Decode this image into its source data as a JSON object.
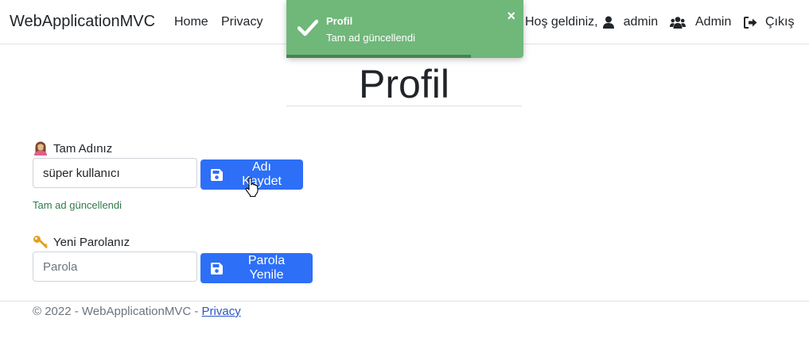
{
  "navbar": {
    "brand": "WebApplicationMVC",
    "links": [
      "Home",
      "Privacy"
    ],
    "greeting": "Hoş geldiniz,",
    "user_name": "admin",
    "admin_label": "Admin",
    "logout_label": "Çıkış"
  },
  "toast": {
    "title": "Profil",
    "message": "Tam ad güncellendi",
    "close": "×",
    "progress": 0.78,
    "color": "#70b77a"
  },
  "page": {
    "title": "Profil"
  },
  "form": {
    "fullname_label": "Tam Adınız",
    "fullname_value": "süper kullanıcı",
    "save_name_button": "Adı Kaydet",
    "success_message": "Tam ad güncellendi",
    "password_label": "Yeni Parolanız",
    "password_placeholder": "Parola",
    "renew_password_button": "Parola Yenile"
  },
  "footer": {
    "text": "© 2022 - WebApplicationMVC - ",
    "privacy_link": "Privacy"
  },
  "colors": {
    "primary": "#2d6ff7",
    "success": "#2f7a4a"
  }
}
